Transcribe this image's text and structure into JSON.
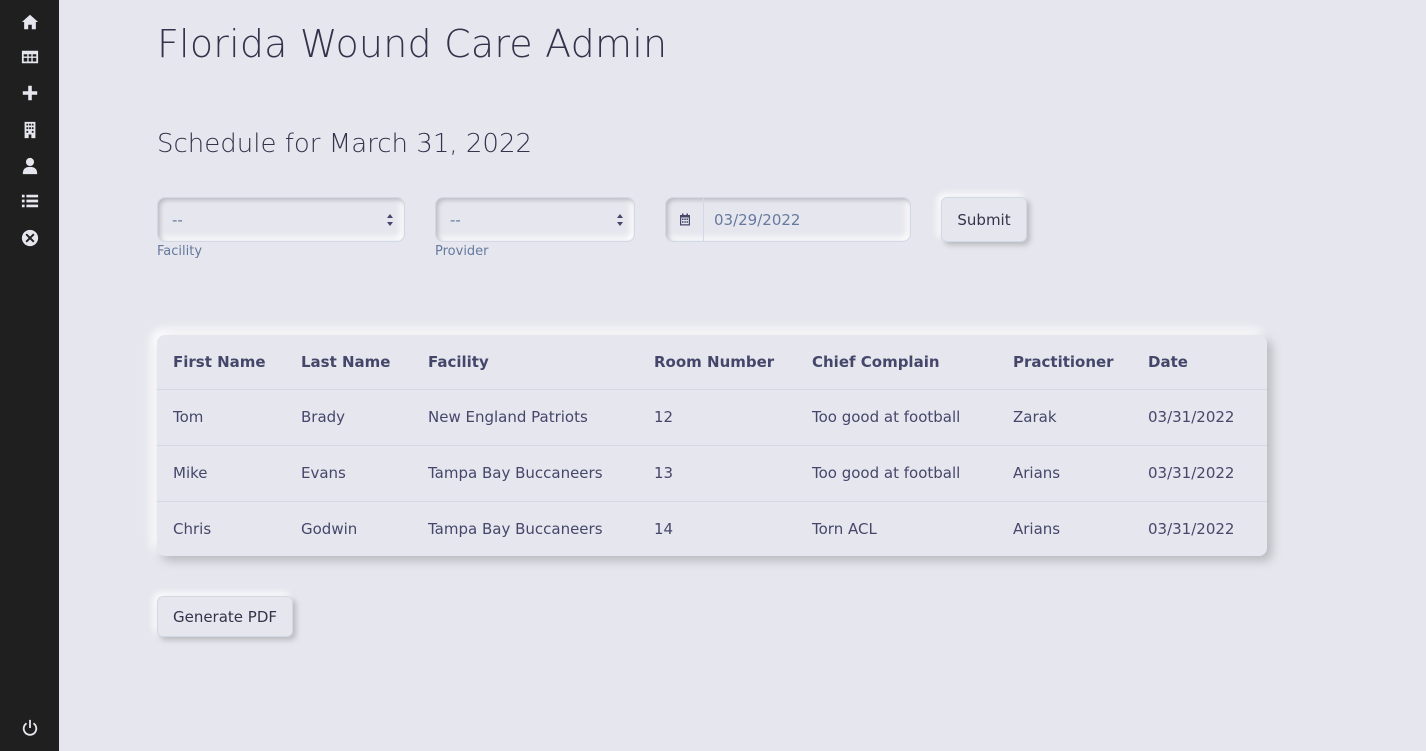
{
  "sidebar": {
    "icons": [
      {
        "name": "home-icon"
      },
      {
        "name": "table-icon"
      },
      {
        "name": "plus-icon"
      },
      {
        "name": "building-icon"
      },
      {
        "name": "doctor-icon"
      },
      {
        "name": "list-icon"
      },
      {
        "name": "close-circle-icon"
      },
      {
        "name": "power-icon"
      }
    ]
  },
  "header": {
    "title": "Florida Wound Care Admin"
  },
  "schedule": {
    "title": "Schedule for March 31, 2022"
  },
  "filters": {
    "facility": {
      "value": "--",
      "label": "Facility"
    },
    "provider": {
      "value": "--",
      "label": "Provider"
    },
    "date": {
      "value": "03/29/2022"
    },
    "submit_label": "Submit"
  },
  "table": {
    "headers": [
      "First Name",
      "Last Name",
      "Facility",
      "Room Number",
      "Chief Complain",
      "Practitioner",
      "Date"
    ],
    "rows": [
      [
        "Tom",
        "Brady",
        "New England Patriots",
        "12",
        "Too good at football",
        "Zarak",
        "03/31/2022"
      ],
      [
        "Mike",
        "Evans",
        "Tampa Bay Buccaneers",
        "13",
        "Too good at football",
        "Arians",
        "03/31/2022"
      ],
      [
        "Chris",
        "Godwin",
        "Tampa Bay Buccaneers",
        "14",
        "Torn ACL",
        "Arians",
        "03/31/2022"
      ]
    ]
  },
  "actions": {
    "generate_pdf_label": "Generate PDF"
  },
  "colors": {
    "background": "#e6e7ee",
    "sidebar": "#1f1f1f",
    "text": "#44476a"
  }
}
